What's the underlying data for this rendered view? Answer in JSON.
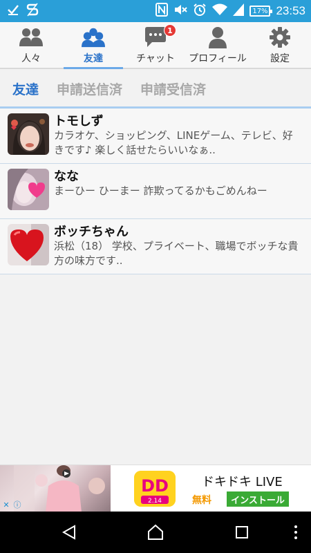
{
  "status_bar": {
    "time": "23:53",
    "battery": "17%",
    "icons": [
      "check-icon",
      "s-icon",
      "nfc-icon",
      "mute-icon",
      "alarm-icon",
      "wifi-icon",
      "signal-icon",
      "battery-icon"
    ]
  },
  "tabs": [
    {
      "label": "人々",
      "icon": "people-icon"
    },
    {
      "label": "友達",
      "icon": "friends-icon",
      "active": true
    },
    {
      "label": "チャット",
      "icon": "chat-icon",
      "badge": "1"
    },
    {
      "label": "プロフィール",
      "icon": "profile-icon"
    },
    {
      "label": "設定",
      "icon": "gear-icon"
    }
  ],
  "subtabs": [
    {
      "label": "友達",
      "active": true
    },
    {
      "label": "申請送信済"
    },
    {
      "label": "申請受信済"
    }
  ],
  "friends": [
    {
      "name": "トモしず",
      "message": "カラオケ、ショッピング、LINEゲーム、テレビ、好きです♪ 楽しく話せたらいいなぁ.."
    },
    {
      "name": "なな",
      "message": "まーひー ひーまー 詐欺ってるかもごめんねー"
    },
    {
      "name": "ボッチちゃん",
      "message": "浜松（18） 学校、プライベート、職場でボッチな貴方の味方です.."
    }
  ],
  "ad": {
    "title": "ドキドキ LIVE",
    "free_label": "無料",
    "install_label": "インストール",
    "logo_text": "DD",
    "logo_sub": "2.14"
  },
  "colors": {
    "status_bar": "#2a9fd8",
    "accent": "#2a72c9",
    "badge": "#e53935",
    "install": "#3aaa35"
  }
}
